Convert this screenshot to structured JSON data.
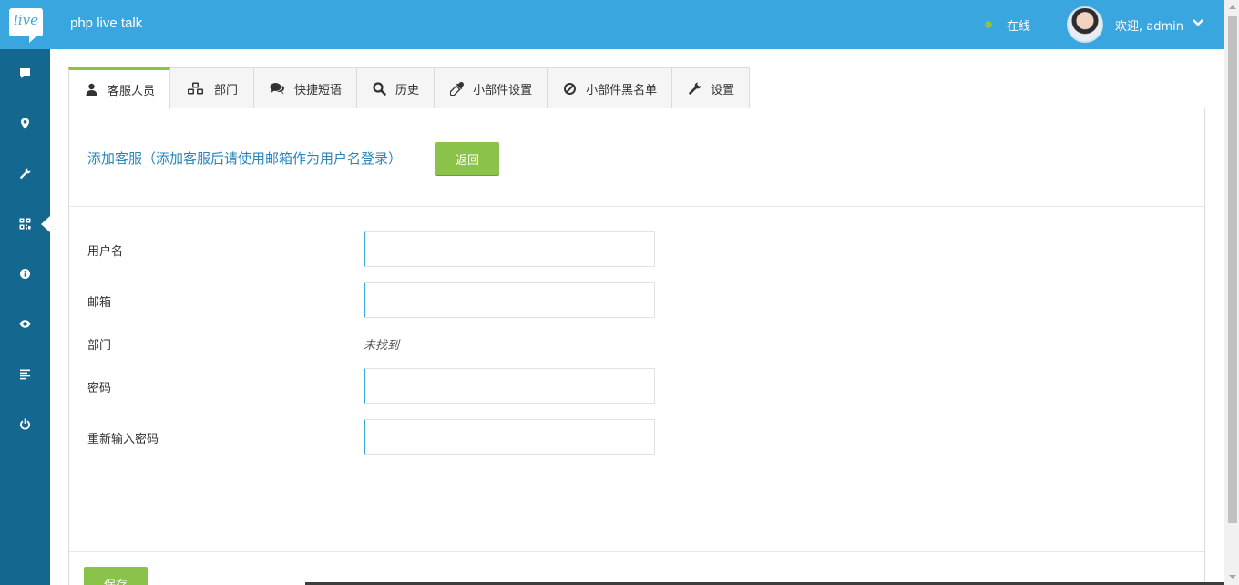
{
  "header": {
    "logo_text": "live",
    "app_title": "php live talk",
    "status": "在线",
    "welcome": "欢迎, admin"
  },
  "sidebar": {
    "items": [
      {
        "icon": "chat-icon"
      },
      {
        "icon": "map-marker-icon"
      },
      {
        "icon": "wrench-icon",
        "active": true
      },
      {
        "icon": "qrcode-icon"
      },
      {
        "icon": "info-icon"
      },
      {
        "icon": "eye-icon"
      },
      {
        "icon": "align-left-icon"
      },
      {
        "icon": "power-icon"
      }
    ]
  },
  "tabs": [
    {
      "label": "客服人员",
      "icon": "user-icon",
      "active": true
    },
    {
      "label": "部门",
      "icon": "cubes-icon"
    },
    {
      "label": "快捷短语",
      "icon": "comments-icon"
    },
    {
      "label": "历史",
      "icon": "search-icon"
    },
    {
      "label": "小部件设置",
      "icon": "eyedropper-icon"
    },
    {
      "label": "小部件黑名单",
      "icon": "ban-icon"
    },
    {
      "label": "设置",
      "icon": "wrench-icon"
    }
  ],
  "panel": {
    "title": "添加客服（添加客服后请使用邮箱作为用户名登录）",
    "back_label": "返回",
    "save_label": "保存"
  },
  "form": {
    "username_label": "用户名",
    "email_label": "邮箱",
    "department_label": "部门",
    "department_value": "未找到",
    "password_label": "密码",
    "confirm_password_label": "重新输入密码"
  },
  "colors": {
    "header": "#3aa6df",
    "sidebar": "#14678f",
    "accent_green": "#8bc34a",
    "title_blue": "#2a85b8"
  }
}
